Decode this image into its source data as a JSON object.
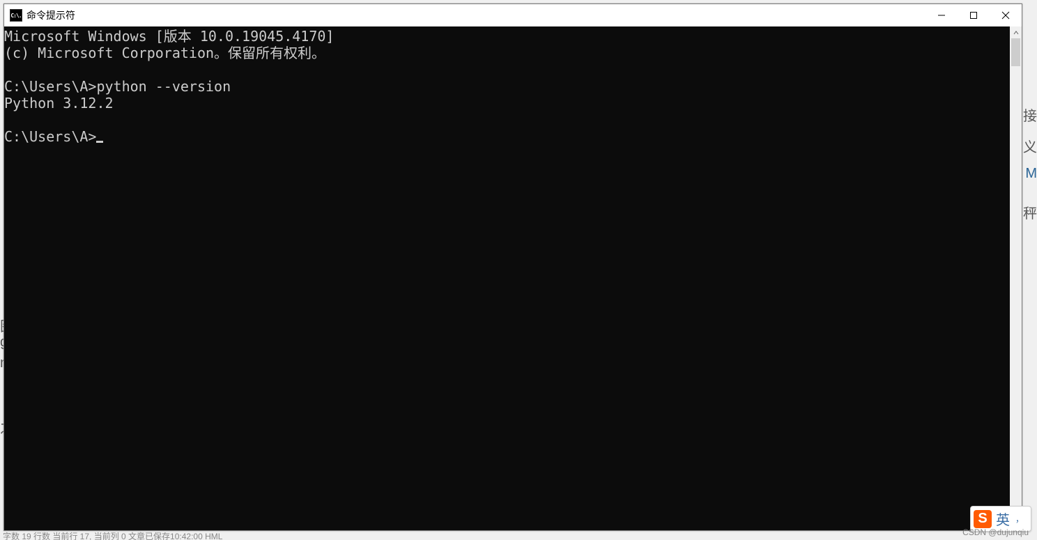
{
  "window": {
    "title": "命令提示符",
    "app_icon_text": "C:\\.",
    "minimize_label": "Minimize",
    "maximize_label": "Maximize",
    "close_label": "Close"
  },
  "terminal": {
    "lines": [
      "Microsoft Windows [版本 10.0.19045.4170]",
      "(c) Microsoft Corporation。保留所有权利。",
      "",
      "C:\\Users\\A>python --version",
      "Python 3.12.2",
      "",
      "C:\\Users\\A>"
    ],
    "cursor_after_last": true
  },
  "background_fragments": {
    "right_chars": [
      "接",
      "义",
      "M",
      "秤"
    ],
    "left_chars": [
      "图",
      "g.",
      "ng",
      "",
      "之"
    ]
  },
  "ime": {
    "logo_letter": "S",
    "main": "英",
    "sub": "，"
  },
  "watermark": "CSDN @dujunqiu",
  "bottom_strip": "字数  19 行数  当前行 17, 当前列 0  文章已保存10:42:00                                                                                                    HML"
}
